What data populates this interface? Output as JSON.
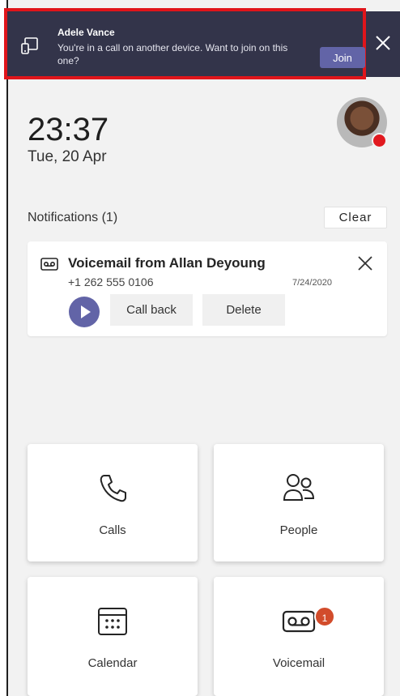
{
  "banner": {
    "caller": "Adele Vance",
    "message": "You're in a call on another device. Want to join on this one?",
    "join_label": "Join",
    "close_icon": "close-icon",
    "device_icon": "device-transfer-icon"
  },
  "clock": {
    "time": "23:37",
    "date": "Tue, 20 Apr"
  },
  "presence": {
    "status_color": "#e1191f"
  },
  "notifications": {
    "header": "Notifications (1)",
    "clear_label": "Clear",
    "items": [
      {
        "icon": "voicemail-icon",
        "title": "Voicemail from Allan Deyoung",
        "number": "+1 262 555 0106",
        "date": "7/24/2020",
        "call_back_label": "Call back",
        "delete_label": "Delete"
      }
    ]
  },
  "tiles": [
    {
      "label": "Calls",
      "icon": "phone-icon"
    },
    {
      "label": "People",
      "icon": "people-icon"
    },
    {
      "label": "Calendar",
      "icon": "calendar-icon"
    },
    {
      "label": "Voicemail",
      "icon": "voicemail-icon",
      "badge": "1"
    }
  ],
  "colors": {
    "banner_bg": "#33344a",
    "banner_highlight": "#e0151b",
    "accent": "#6264a7",
    "badge": "#d24c2b"
  }
}
